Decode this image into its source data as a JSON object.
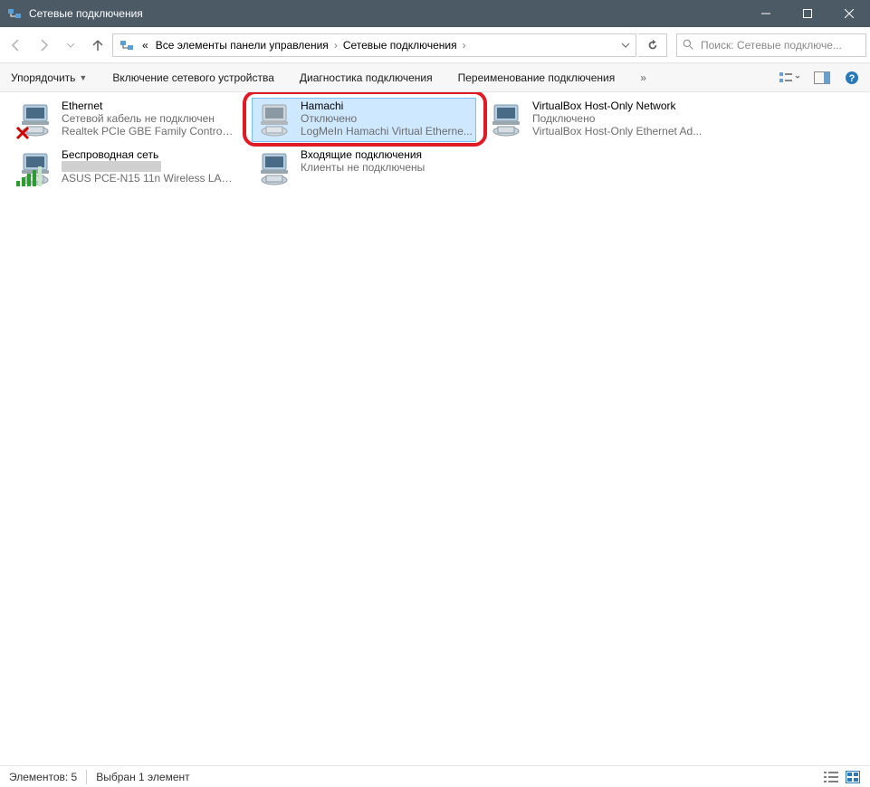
{
  "window": {
    "title": "Сетевые подключения"
  },
  "breadcrumbs": {
    "prefix": "«",
    "items": [
      "Все элементы панели управления",
      "Сетевые подключения"
    ]
  },
  "search": {
    "placeholder": "Поиск: Сетевые подключе..."
  },
  "toolbar": {
    "organize": "Упорядочить",
    "enable": "Включение сетевого устройства",
    "diagnose": "Диагностика подключения",
    "rename": "Переименование подключения",
    "overflow": "»"
  },
  "connections": {
    "ethernet": {
      "name": "Ethernet",
      "status": "Сетевой кабель не подключен",
      "device": "Realtek PCIe GBE Family Controller"
    },
    "wireless": {
      "name": "Беспроводная сеть",
      "status": "",
      "device": "ASUS PCE-N15 11n Wireless LAN ..."
    },
    "hamachi": {
      "name": "Hamachi",
      "status": "Отключено",
      "device": "LogMeIn Hamachi Virtual Etherne..."
    },
    "incoming": {
      "name": "Входящие подключения",
      "status": "Клиенты не подключены",
      "device": ""
    },
    "vbox": {
      "name": "VirtualBox Host-Only Network",
      "status": "Подключено",
      "device": "VirtualBox Host-Only Ethernet Ad..."
    }
  },
  "statusbar": {
    "count": "Элементов: 5",
    "selected": "Выбран 1 элемент"
  }
}
